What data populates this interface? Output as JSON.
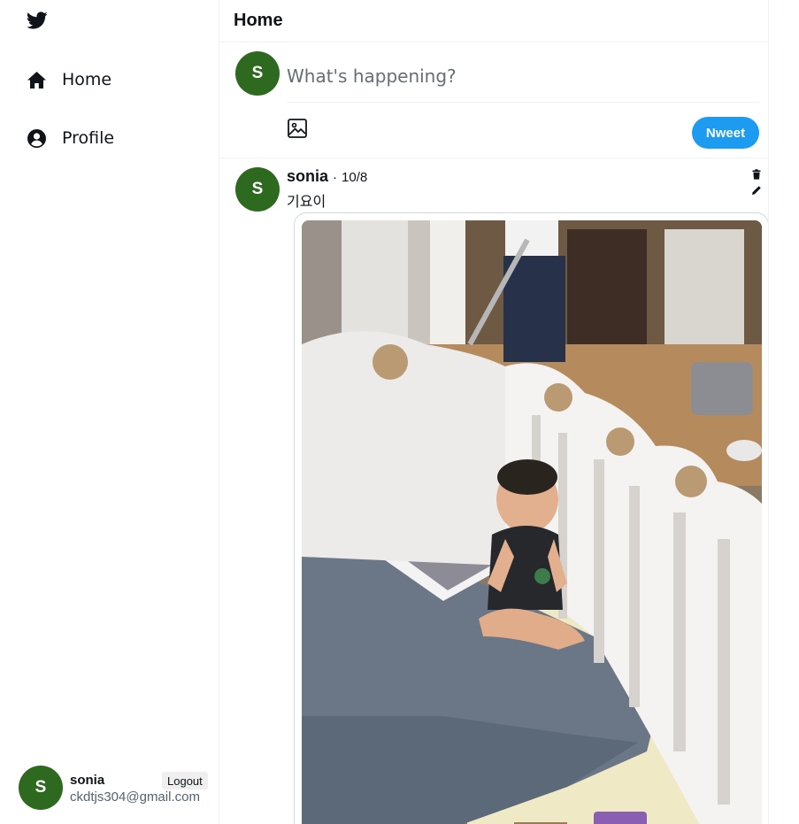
{
  "sidebar": {
    "logo": {
      "icon": "twitter-bird-icon",
      "color": "#0f1419"
    },
    "nav": [
      {
        "label": "Home",
        "icon": "home-icon"
      },
      {
        "label": "Profile",
        "icon": "user-circle-icon"
      }
    ],
    "account": {
      "avatar_initial": "S",
      "name": "sonia",
      "email": "ckdtjs304@gmail.com",
      "logout_label": "Logout"
    }
  },
  "main": {
    "title": "Home",
    "composer": {
      "avatar_initial": "S",
      "placeholder": "What's happening?",
      "image_icon": "image-icon",
      "submit_label": "Nweet"
    },
    "tweets": [
      {
        "avatar_initial": "S",
        "author": "sonia",
        "separator": "·",
        "date": "10/8",
        "text": "기요이",
        "delete_icon": "trash-icon",
        "edit_icon": "pencil-icon",
        "photo": "baby-in-playpen-photo"
      }
    ]
  },
  "colors": {
    "avatar": "#2d6a1f",
    "accent": "#1d9bf0",
    "border": "#eff3f4"
  }
}
